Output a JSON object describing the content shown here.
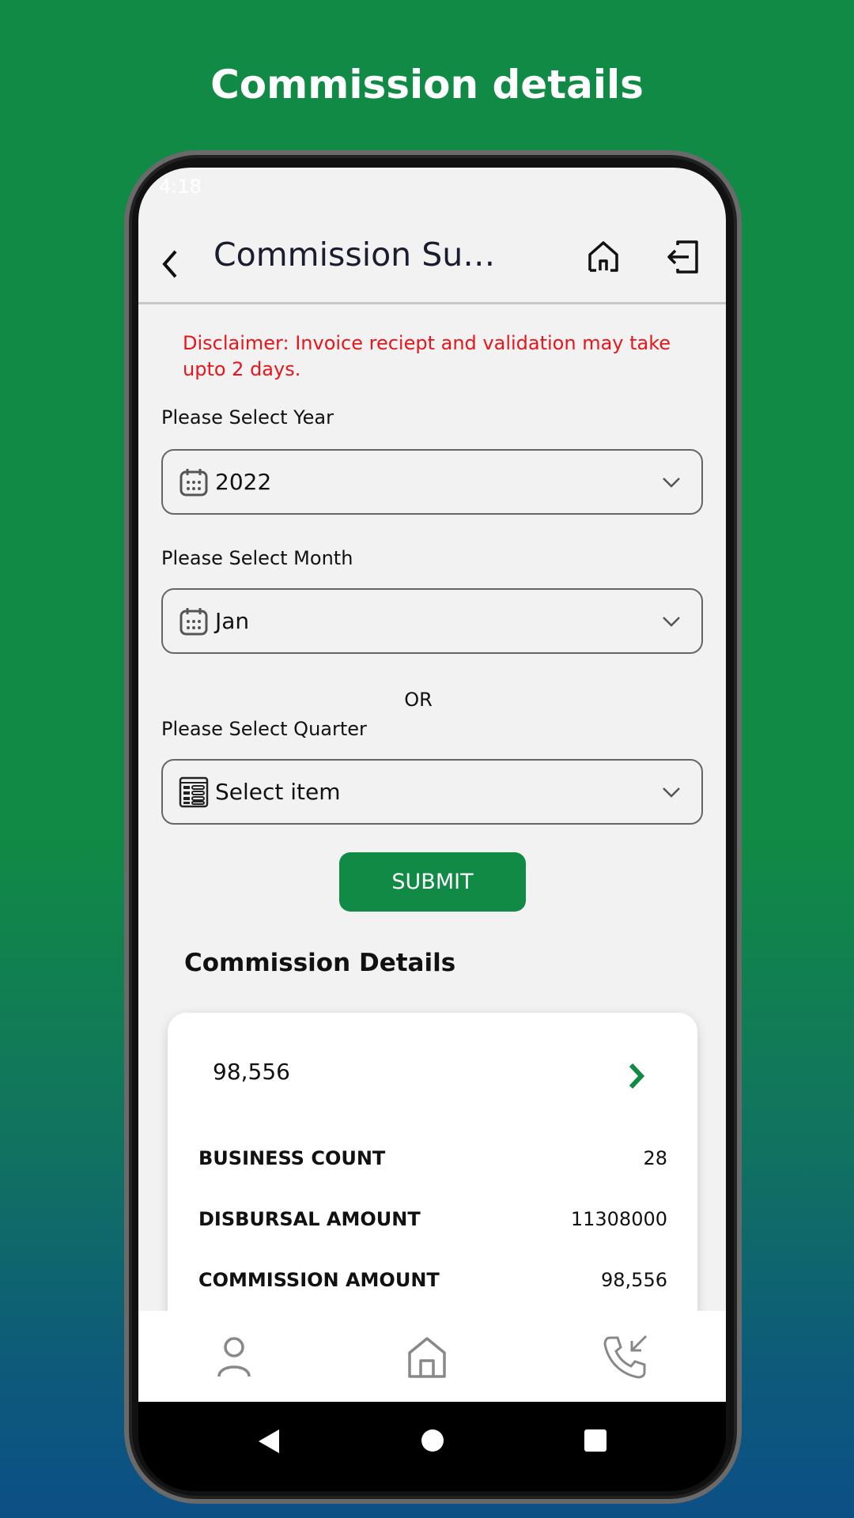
{
  "promo_title": "Commission details",
  "status_bar": {
    "time": "4:18"
  },
  "header": {
    "title": "Commission Summar...",
    "back_icon": "chevron-left-icon",
    "home_icon": "home-icon",
    "logout_icon": "logout-icon"
  },
  "disclaimer": "Disclaimer: Invoice reciept and validation may take upto 2 days.",
  "year": {
    "label": "Please Select Year",
    "value": "2022"
  },
  "month": {
    "label": "Please Select Month",
    "value": "Jan"
  },
  "or_text": "OR",
  "quarter": {
    "label": "Please Select Quarter",
    "placeholder": "Select item"
  },
  "submit_label": "SUBMIT",
  "section_title": "Commission Details",
  "card": {
    "amount": "98,556",
    "rows": [
      {
        "label": "BUSINESS COUNT",
        "value": "28"
      },
      {
        "label": "DISBURSAL AMOUNT",
        "value": "11308000"
      },
      {
        "label": "COMMISSION AMOUNT",
        "value": "98,556"
      }
    ]
  },
  "colors": {
    "brand_green": "#118a45",
    "disclaimer_red": "#e8151b"
  }
}
